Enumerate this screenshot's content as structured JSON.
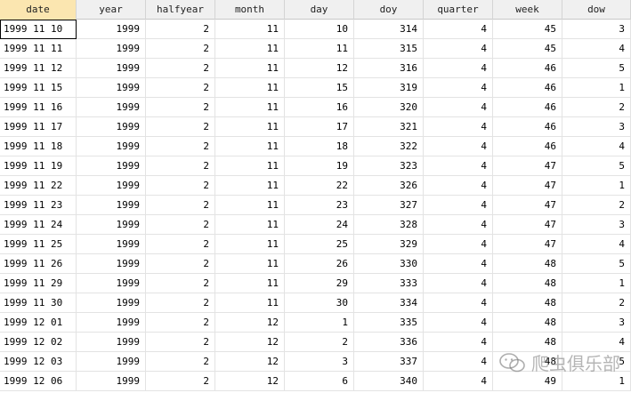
{
  "columns": [
    "date",
    "year",
    "halfyear",
    "month",
    "day",
    "doy",
    "quarter",
    "week",
    "dow"
  ],
  "rows": [
    [
      "1999 11 10",
      "1999",
      "2",
      "11",
      "10",
      "314",
      "4",
      "45",
      "3"
    ],
    [
      "1999 11 11",
      "1999",
      "2",
      "11",
      "11",
      "315",
      "4",
      "45",
      "4"
    ],
    [
      "1999 11 12",
      "1999",
      "2",
      "11",
      "12",
      "316",
      "4",
      "46",
      "5"
    ],
    [
      "1999 11 15",
      "1999",
      "2",
      "11",
      "15",
      "319",
      "4",
      "46",
      "1"
    ],
    [
      "1999 11 16",
      "1999",
      "2",
      "11",
      "16",
      "320",
      "4",
      "46",
      "2"
    ],
    [
      "1999 11 17",
      "1999",
      "2",
      "11",
      "17",
      "321",
      "4",
      "46",
      "3"
    ],
    [
      "1999 11 18",
      "1999",
      "2",
      "11",
      "18",
      "322",
      "4",
      "46",
      "4"
    ],
    [
      "1999 11 19",
      "1999",
      "2",
      "11",
      "19",
      "323",
      "4",
      "47",
      "5"
    ],
    [
      "1999 11 22",
      "1999",
      "2",
      "11",
      "22",
      "326",
      "4",
      "47",
      "1"
    ],
    [
      "1999 11 23",
      "1999",
      "2",
      "11",
      "23",
      "327",
      "4",
      "47",
      "2"
    ],
    [
      "1999 11 24",
      "1999",
      "2",
      "11",
      "24",
      "328",
      "4",
      "47",
      "3"
    ],
    [
      "1999 11 25",
      "1999",
      "2",
      "11",
      "25",
      "329",
      "4",
      "47",
      "4"
    ],
    [
      "1999 11 26",
      "1999",
      "2",
      "11",
      "26",
      "330",
      "4",
      "48",
      "5"
    ],
    [
      "1999 11 29",
      "1999",
      "2",
      "11",
      "29",
      "333",
      "4",
      "48",
      "1"
    ],
    [
      "1999 11 30",
      "1999",
      "2",
      "11",
      "30",
      "334",
      "4",
      "48",
      "2"
    ],
    [
      "1999 12 01",
      "1999",
      "2",
      "12",
      "1",
      "335",
      "4",
      "48",
      "3"
    ],
    [
      "1999 12 02",
      "1999",
      "2",
      "12",
      "2",
      "336",
      "4",
      "48",
      "4"
    ],
    [
      "1999 12 03",
      "1999",
      "2",
      "12",
      "3",
      "337",
      "4",
      "48",
      "5"
    ],
    [
      "1999 12 06",
      "1999",
      "2",
      "12",
      "6",
      "340",
      "4",
      "49",
      "1"
    ]
  ],
  "watermark": {
    "text": "爬虫俱乐部",
    "icon": "wechat-icon"
  }
}
